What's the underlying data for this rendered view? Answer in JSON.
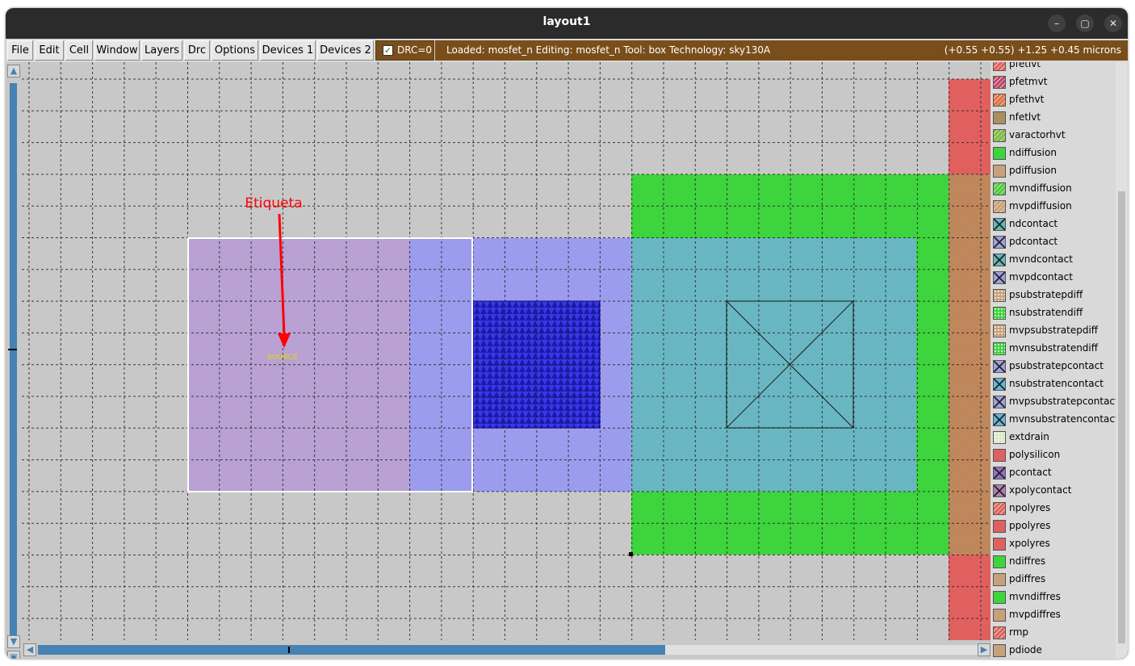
{
  "window": {
    "title": "layout1",
    "controls": [
      "–",
      "▢",
      "✕"
    ]
  },
  "menu": [
    "File",
    "Edit",
    "Cell",
    "Window",
    "Layers",
    "Drc",
    "Options",
    "Devices 1",
    "Devices 2"
  ],
  "drc": {
    "checked": true,
    "label": "DRC=0"
  },
  "status": {
    "left": "Loaded: mosfet_n  Editing: mosfet_n  Tool: box   Technology: sky130A",
    "right": "(+0.55 +0.55) +1.25 +0.45 microns"
  },
  "annotation": {
    "text": "Etiqueta",
    "color": "#ff0000"
  },
  "canvas_label": {
    "text": "SOURCE",
    "color": "#e8d800"
  },
  "colors": {
    "background": "#c8c8c8",
    "ndiffusion": "#3ed43e",
    "polysilicon": "#e06060",
    "metal1": "#b8a0d8",
    "locali": "#a0a0f0",
    "viali": "#2020e0",
    "contact_area": "#62b8b8",
    "statusbar": "#7a4e1a",
    "scroll_accent": "#4682b4"
  },
  "layers": [
    {
      "name": "pfetlvt",
      "icon": "pfetlvt-icon",
      "color": "#e06060",
      "pattern": "diag"
    },
    {
      "name": "pfetmvt",
      "icon": "pfetmvt-icon",
      "color": "#c04070",
      "pattern": "diag"
    },
    {
      "name": "pfethvt",
      "icon": "pfethvt-icon",
      "color": "#e07040",
      "pattern": "diag"
    },
    {
      "name": "nfetlvt",
      "icon": "nfetlvt-icon",
      "color": "#a89060",
      "pattern": "solid"
    },
    {
      "name": "varactorhvt",
      "icon": "varactorhvt-icon",
      "color": "#70c040",
      "pattern": "diag"
    },
    {
      "name": "ndiffusion",
      "icon": "ndiffusion-icon",
      "color": "#3ed43e",
      "pattern": "solid"
    },
    {
      "name": "pdiffusion",
      "icon": "pdiffusion-icon",
      "color": "#c8a07a",
      "pattern": "solid"
    },
    {
      "name": "mvndiffusion",
      "icon": "mvndiffusion-icon",
      "color": "#3ed43e",
      "pattern": "diag"
    },
    {
      "name": "mvpdiffusion",
      "icon": "mvpdiffusion-icon",
      "color": "#c8a07a",
      "pattern": "diag"
    },
    {
      "name": "ndcontact",
      "icon": "ndcontact-icon",
      "color": "#62b8b8",
      "pattern": "cross"
    },
    {
      "name": "pdcontact",
      "icon": "pdcontact-icon",
      "color": "#a0a0e0",
      "pattern": "cross"
    },
    {
      "name": "mvndcontact",
      "icon": "mvndcontact-icon",
      "color": "#62b8b8",
      "pattern": "cross"
    },
    {
      "name": "mvpdcontact",
      "icon": "mvpdcontact-icon",
      "color": "#a0a0e0",
      "pattern": "cross"
    },
    {
      "name": "psubstratepdiff",
      "icon": "psubstratepdiff-icon",
      "color": "#c8a07a",
      "pattern": "dots"
    },
    {
      "name": "nsubstratendiff",
      "icon": "nsubstratendiff-icon",
      "color": "#3ed43e",
      "pattern": "dots"
    },
    {
      "name": "mvpsubstratepdiff",
      "icon": "mvpsubstratepdiff-icon",
      "color": "#c8a07a",
      "pattern": "dots"
    },
    {
      "name": "mvnsubstratendiff",
      "icon": "mvnsubstratendiff-icon",
      "color": "#3ed43e",
      "pattern": "dots"
    },
    {
      "name": "psubstratepcontact",
      "icon": "psubstratepcontact-icon",
      "color": "#a0a0e0",
      "pattern": "cross"
    },
    {
      "name": "nsubstratencontact",
      "icon": "nsubstratencontact-icon",
      "color": "#62b8d8",
      "pattern": "cross"
    },
    {
      "name": "mvpsubstratepcontact",
      "icon": "mvpsubstratepcontact-icon",
      "color": "#a0a0e0",
      "pattern": "cross"
    },
    {
      "name": "mvnsubstratencontact",
      "icon": "mvnsubstratencontact-icon",
      "color": "#62b8d8",
      "pattern": "cross"
    },
    {
      "name": "extdrain",
      "icon": "extdrain-icon",
      "color": "#d8e8c8",
      "pattern": "dots"
    },
    {
      "name": "polysilicon",
      "icon": "polysilicon-icon",
      "color": "#e06060",
      "pattern": "solid"
    },
    {
      "name": "pcontact",
      "icon": "pcontact-icon",
      "color": "#9070c0",
      "pattern": "cross"
    },
    {
      "name": "xpolycontact",
      "icon": "xpolycontact-icon",
      "color": "#b080b0",
      "pattern": "cross"
    },
    {
      "name": "npolyres",
      "icon": "npolyres-icon",
      "color": "#e06060",
      "pattern": "diag"
    },
    {
      "name": "ppolyres",
      "icon": "ppolyres-icon",
      "color": "#e06060",
      "pattern": "solid"
    },
    {
      "name": "xpolyres",
      "icon": "xpolyres-icon",
      "color": "#e06060",
      "pattern": "solid"
    },
    {
      "name": "ndiffres",
      "icon": "ndiffres-icon",
      "color": "#3ed43e",
      "pattern": "solid"
    },
    {
      "name": "pdiffres",
      "icon": "pdiffres-icon",
      "color": "#c8a07a",
      "pattern": "solid"
    },
    {
      "name": "mvndiffres",
      "icon": "mvndiffres-icon",
      "color": "#3ed43e",
      "pattern": "solid"
    },
    {
      "name": "mvpdiffres",
      "icon": "mvpdiffres-icon",
      "color": "#c8a07a",
      "pattern": "solid"
    },
    {
      "name": "rmp",
      "icon": "rmp-icon",
      "color": "#e06060",
      "pattern": "diag"
    },
    {
      "name": "pdiode",
      "icon": "pdiode-icon",
      "color": "#c8a07a",
      "pattern": "solid"
    }
  ]
}
